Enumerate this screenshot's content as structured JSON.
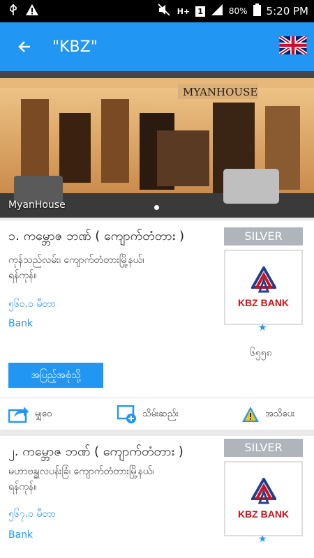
{
  "status_bar": {
    "battery": "80%",
    "time": "5:20 PM",
    "network": "H+",
    "sim": "1"
  },
  "app_bar": {
    "title": "\"KBZ\""
  },
  "banner": {
    "caption": "MyanHouse"
  },
  "colors": {
    "primary": "#2196f3",
    "badge": "#b0b5bc",
    "logo_red": "#d0121b",
    "logo_blue": "#1f3f8f"
  },
  "items": [
    {
      "title": "၁. ကမ္ဘောဇ ဘဏ် ( ကျောက်တံတား )",
      "address_line1": "ကုန်သည်လမ်း၊ ကျောက်တံတားမြို့နယ်၊",
      "address_line2": "ရန်ကုန်။",
      "distance": "၅၆၀.၀ မီတာ",
      "category": "Bank",
      "badge": "SILVER",
      "logo_text": "KBZ BANK",
      "count": "၆၅၅၈",
      "direction_button": "အပြည့်အစုံသို့",
      "actions": {
        "share": "မျှဝေ",
        "save": "သိမ်းဆည်း",
        "report": "အသိပေး"
      }
    },
    {
      "title": "၂. ကမ္ဘောဇ ဘဏ် ( ကျောက်တံတား )",
      "address_line1": "မဟာဗန္ဓုလပန်းခြံ၊ ကျောက်တံတားမြို့နယ်၊",
      "address_line2": "ရန်ကုန်။",
      "distance": "၅၆၇.၀ မီတာ",
      "category": "Bank",
      "badge": "SILVER",
      "logo_text": "KBZ BANK"
    }
  ]
}
